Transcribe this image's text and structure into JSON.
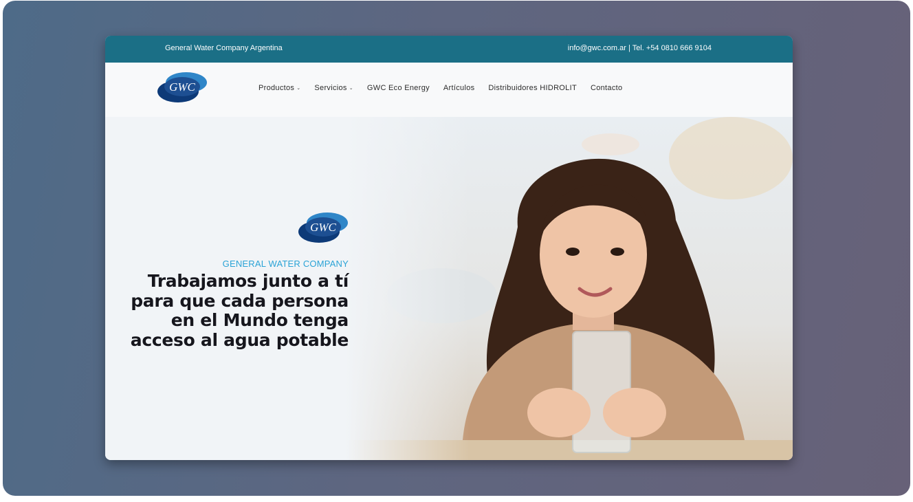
{
  "topbar": {
    "company": "General Water Company Argentina",
    "contact": "info@gwc.com.ar | Tel. +54 0810 666 9104"
  },
  "logo": {
    "text": "GWC"
  },
  "nav": {
    "items": [
      {
        "label": "Productos",
        "has_dropdown": true
      },
      {
        "label": "Servicios",
        "has_dropdown": true
      },
      {
        "label": "GWC Eco Energy",
        "has_dropdown": false
      },
      {
        "label": "Artículos",
        "has_dropdown": false
      },
      {
        "label": "Distribuidores HIDROLIT",
        "has_dropdown": false
      },
      {
        "label": "Contacto",
        "has_dropdown": false
      }
    ]
  },
  "hero": {
    "eyebrow": "GENERAL WATER COMPANY",
    "headline_lines": [
      "Trabajamos junto a tí",
      "para que cada persona",
      "en el Mundo tenga",
      "acceso al agua potable"
    ]
  },
  "colors": {
    "topbar": "#1b6f86",
    "accent": "#2aa3d6",
    "logo_dark": "#0d3a78",
    "logo_light": "#2f86c8"
  }
}
